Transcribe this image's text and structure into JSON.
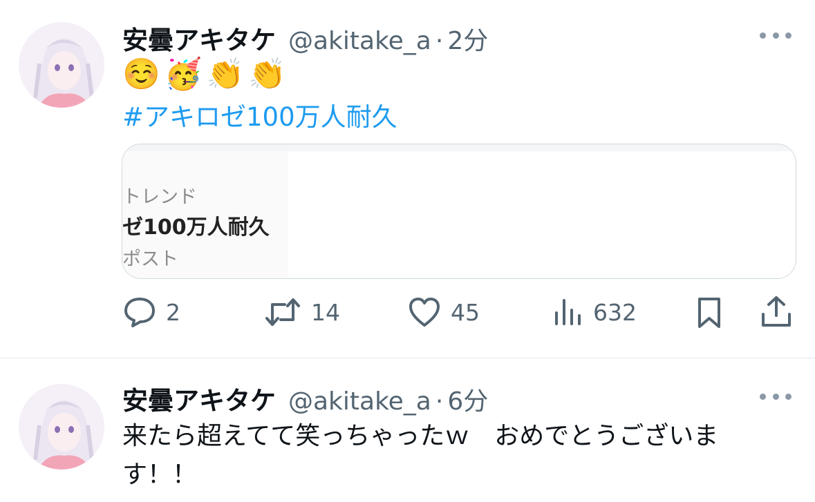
{
  "tweets": [
    {
      "author_name": "安曇アキタケ",
      "handle": "@akitake_a",
      "separator": "·",
      "time": "2分",
      "emojis": [
        "☺️",
        "🥳",
        "👏",
        "👏"
      ],
      "hashtag": "#アキロゼ100万人耐久",
      "card": {
        "line1": "トレンド",
        "line2": "ゼ100万人耐久",
        "line3": "ポスト"
      },
      "actions": {
        "replies": "2",
        "reposts": "14",
        "likes": "45",
        "views": "632"
      }
    },
    {
      "author_name": "安曇アキタケ",
      "handle": "@akitake_a",
      "separator": "·",
      "time": "6分",
      "text": "来たら超えてて笑っちゃったｗ　おめでとうございます！！"
    }
  ],
  "colors": {
    "link": "#1d9bf0",
    "secondary_text": "#536471",
    "border": "#cfd9de"
  },
  "icons": [
    "more-icon",
    "reply-icon",
    "repost-icon",
    "like-icon",
    "views-icon",
    "bookmark-icon",
    "share-icon"
  ]
}
